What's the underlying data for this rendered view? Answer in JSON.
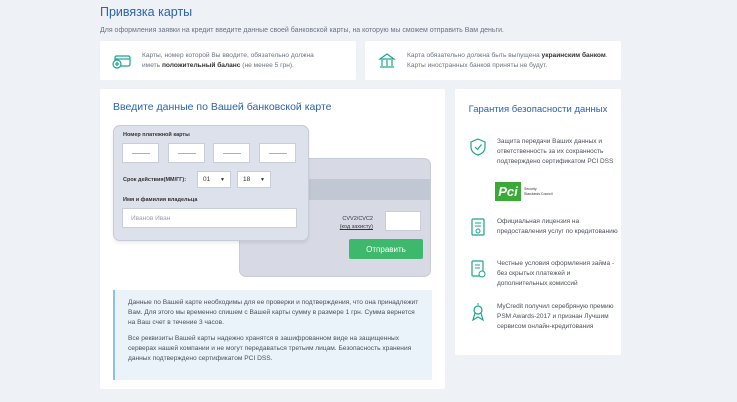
{
  "page": {
    "title": "Привязка карты",
    "subtitle": "Для оформления заявки на кредит введите данные своей банковской карты, на которую мы сможем отправить Вам деньги."
  },
  "info": {
    "left": {
      "pre": "Карты, номер которой Вы вводите, обязательно должна иметь ",
      "bold": "положительный баланс",
      "post": " (не менее 5 грн)."
    },
    "right": {
      "pre": "Карта обязательно должна быть выпущена ",
      "bold": "украинским банком",
      "post": ". Карты иностранных банков приняты не будут."
    }
  },
  "form": {
    "title": "Введите данные по Вашей банковской карте",
    "card_number_label": "Номер платежной карты",
    "expiry_label": "Срок действия(ММ/ГГ):",
    "month": "01",
    "year": "18",
    "holder_label": "Имя и фамилия владельца",
    "holder_placeholder": "Иванов Иван",
    "cvv_label": "CVV2/CVC2",
    "cvv_sub": "(код захисту)",
    "submit": "Отправить",
    "note1": "Данные по Вашей карте необходимы для ее проверки и подтверждения, что она принадлежит Вам. Для этого мы временно спишем с Вашей карты сумму в размере 1 грн. Сумма вернется на Ваш счет в течение 3 часов.",
    "note2": "Все реквизиты Вашей карты надежно хранятся в зашифрованном виде на защищенных серверах нашей компании и не могут передаваться третьим лицам. Безопасность хранения данных подтверждено сертификатом PCI DSS."
  },
  "guarantee": {
    "title": "Гарантия безопасности данных",
    "items": [
      "Защита передачи Ваших данных и ответственность за их сохранность подтверждено сертификатом PCI DSS",
      "Официальная лицензия на предоставления услуг по кредитованию",
      "Честные условия оформления займа - без скрытых платежей и дополнительных комиссий",
      "MyCredit получил серебряную премию PSM Awards-2017 и признан Лучшим сервисом онлайн-кредитования"
    ],
    "pci_logo": "Pci",
    "pci_text1": "Security",
    "pci_text2": "Standards Council"
  },
  "colors": {
    "accent": "#2a63b0",
    "button": "#3db86c",
    "icon": "#1ba58c"
  }
}
